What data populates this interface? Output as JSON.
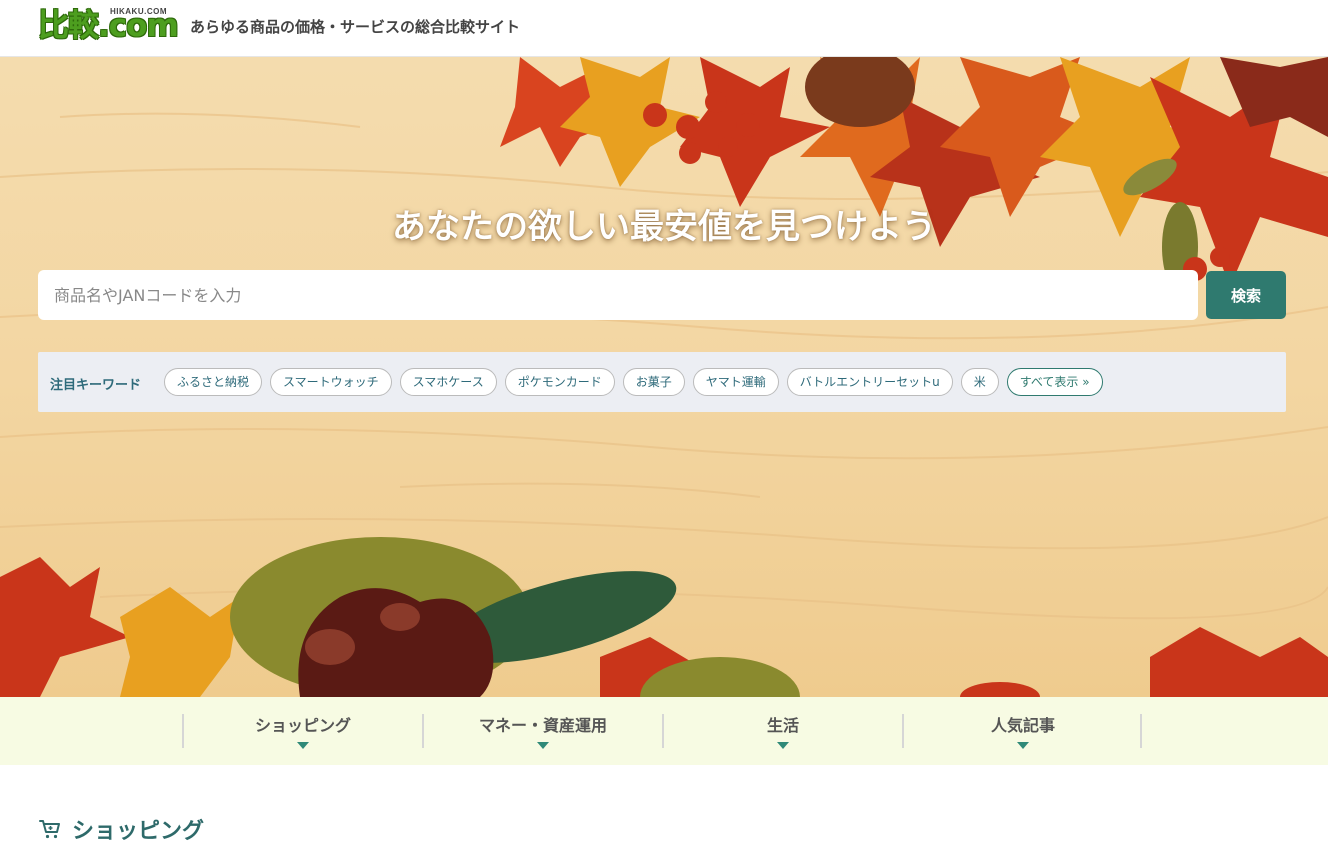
{
  "header": {
    "logo_text": "比較.com",
    "logo_small": "HIKAKU.COM",
    "tagline": "あらゆる商品の価格・サービスの総合比較サイト"
  },
  "hero": {
    "title": "あなたの欲しい最安値を見つけよう",
    "search": {
      "placeholder": "商品名やJANコードを入力",
      "value": "",
      "button_label": "検索"
    },
    "keywords": {
      "label": "注目キーワード",
      "items": [
        "ふるさと納税",
        "スマートウォッチ",
        "スマホケース",
        "ポケモンカード",
        "お菓子",
        "ヤマト運輸",
        "バトルエントリーセットu",
        "米"
      ],
      "show_all": "すべて表示 »"
    }
  },
  "categories": [
    {
      "label": "ショッピング"
    },
    {
      "label": "マネー・資産運用"
    },
    {
      "label": "生活"
    },
    {
      "label": "人気記事"
    }
  ],
  "section": {
    "title": "ショッピング",
    "icon": "cart-icon"
  },
  "colors": {
    "accent": "#2f7a6f",
    "brand_green": "#4d9e1f",
    "nav_bg": "#f7fbe3",
    "hero_bg": "#f3d8a6"
  }
}
